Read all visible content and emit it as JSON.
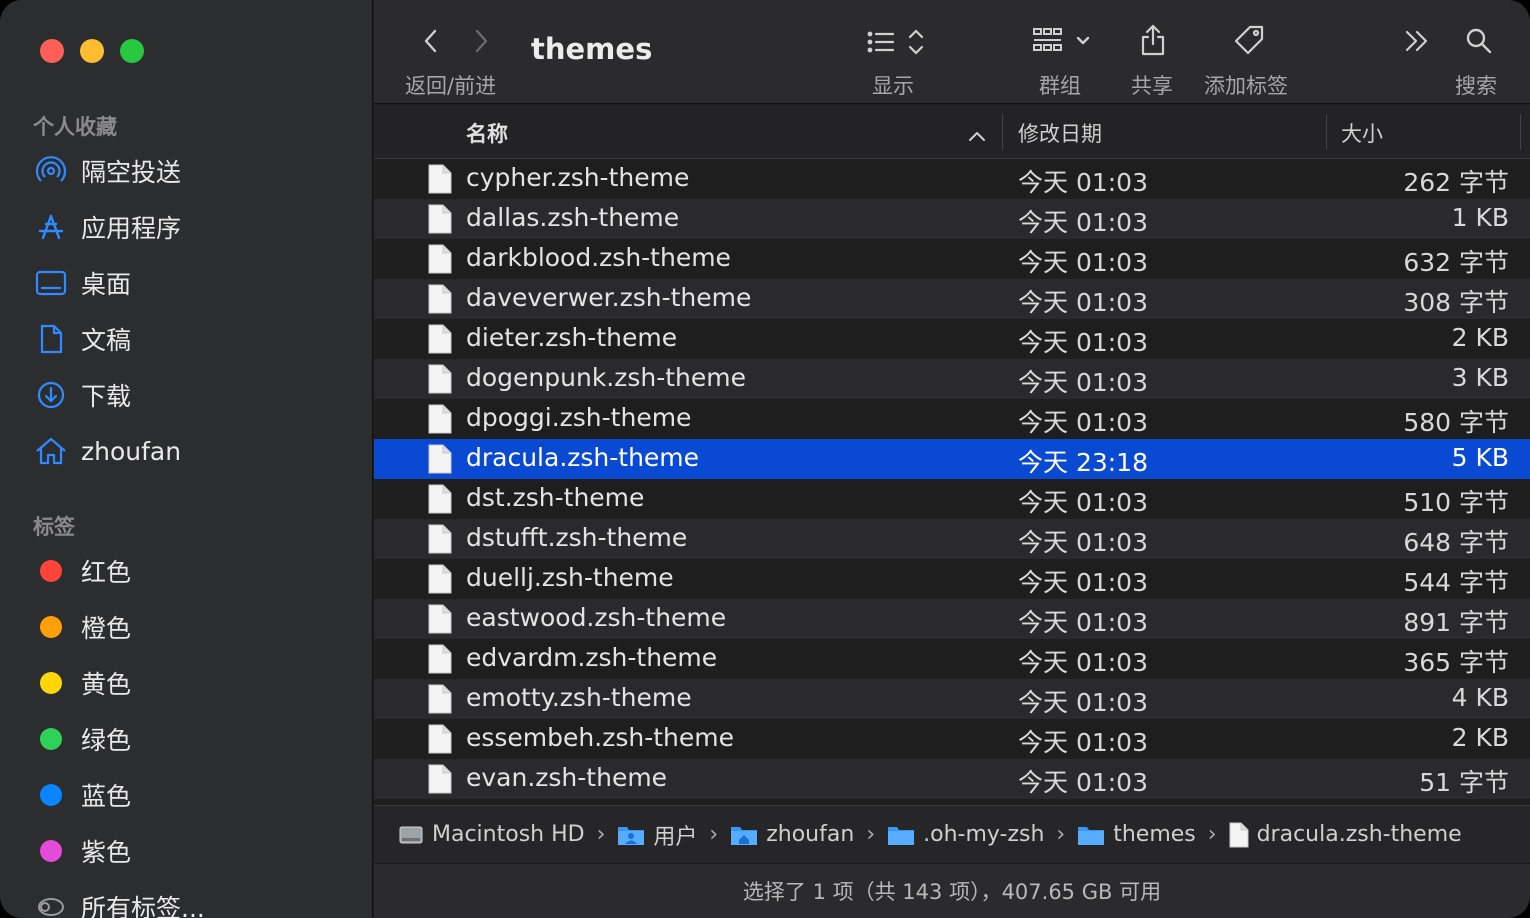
{
  "window": {
    "title": "themes"
  },
  "sidebar": {
    "favorites_header": "个人收藏",
    "favorites": [
      {
        "label": "隔空投送",
        "icon": "airdrop-icon"
      },
      {
        "label": "应用程序",
        "icon": "applications-icon"
      },
      {
        "label": "桌面",
        "icon": "desktop-icon"
      },
      {
        "label": "文稿",
        "icon": "document-icon"
      },
      {
        "label": "下载",
        "icon": "download-icon"
      },
      {
        "label": "zhoufan",
        "icon": "home-icon"
      }
    ],
    "tags_header": "标签",
    "tags": [
      {
        "label": "红色",
        "color": "#ff453a"
      },
      {
        "label": "橙色",
        "color": "#ff9f0a"
      },
      {
        "label": "黄色",
        "color": "#ffd60a"
      },
      {
        "label": "绿色",
        "color": "#30d158"
      },
      {
        "label": "蓝色",
        "color": "#0a84ff"
      },
      {
        "label": "紫色",
        "color": "#e34bd8"
      }
    ],
    "all_tags": "所有标签..."
  },
  "toolbar": {
    "nav_label": "返回/前进",
    "view_label": "显示",
    "group_label": "群组",
    "share_label": "共享",
    "tag_label": "添加标签",
    "search_label": "搜索"
  },
  "columns": {
    "name": "名称",
    "modified": "修改日期",
    "size": "大小"
  },
  "files": [
    {
      "name": "cypher.zsh-theme",
      "modified": "今天 01:03",
      "size": "262 字节"
    },
    {
      "name": "dallas.zsh-theme",
      "modified": "今天 01:03",
      "size": "1 KB"
    },
    {
      "name": "darkblood.zsh-theme",
      "modified": "今天 01:03",
      "size": "632 字节"
    },
    {
      "name": "daveverwer.zsh-theme",
      "modified": "今天 01:03",
      "size": "308 字节"
    },
    {
      "name": "dieter.zsh-theme",
      "modified": "今天 01:03",
      "size": "2 KB"
    },
    {
      "name": "dogenpunk.zsh-theme",
      "modified": "今天 01:03",
      "size": "3 KB"
    },
    {
      "name": "dpoggi.zsh-theme",
      "modified": "今天 01:03",
      "size": "580 字节"
    },
    {
      "name": "dracula.zsh-theme",
      "modified": "今天 23:18",
      "size": "5 KB",
      "selected": true
    },
    {
      "name": "dst.zsh-theme",
      "modified": "今天 01:03",
      "size": "510 字节"
    },
    {
      "name": "dstufft.zsh-theme",
      "modified": "今天 01:03",
      "size": "648 字节"
    },
    {
      "name": "duellj.zsh-theme",
      "modified": "今天 01:03",
      "size": "544 字节"
    },
    {
      "name": "eastwood.zsh-theme",
      "modified": "今天 01:03",
      "size": "891 字节"
    },
    {
      "name": "edvardm.zsh-theme",
      "modified": "今天 01:03",
      "size": "365 字节"
    },
    {
      "name": "emotty.zsh-theme",
      "modified": "今天 01:03",
      "size": "4 KB"
    },
    {
      "name": "essembeh.zsh-theme",
      "modified": "今天 01:03",
      "size": "2 KB"
    },
    {
      "name": "evan.zsh-theme",
      "modified": "今天 01:03",
      "size": "51 字节"
    }
  ],
  "path": [
    {
      "label": "Macintosh HD",
      "icon": "hard-drive-icon"
    },
    {
      "label": "用户",
      "icon": "users-folder-icon"
    },
    {
      "label": "zhoufan",
      "icon": "home-folder-icon"
    },
    {
      "label": ".oh-my-zsh",
      "icon": "folder-icon"
    },
    {
      "label": "themes",
      "icon": "folder-icon"
    },
    {
      "label": "dracula.zsh-theme",
      "icon": "file-icon"
    }
  ],
  "status": "选择了 1 项（共 143 项），407.65 GB 可用",
  "colors": {
    "selection": "#0a4ad3",
    "accent": "#0a84ff"
  }
}
